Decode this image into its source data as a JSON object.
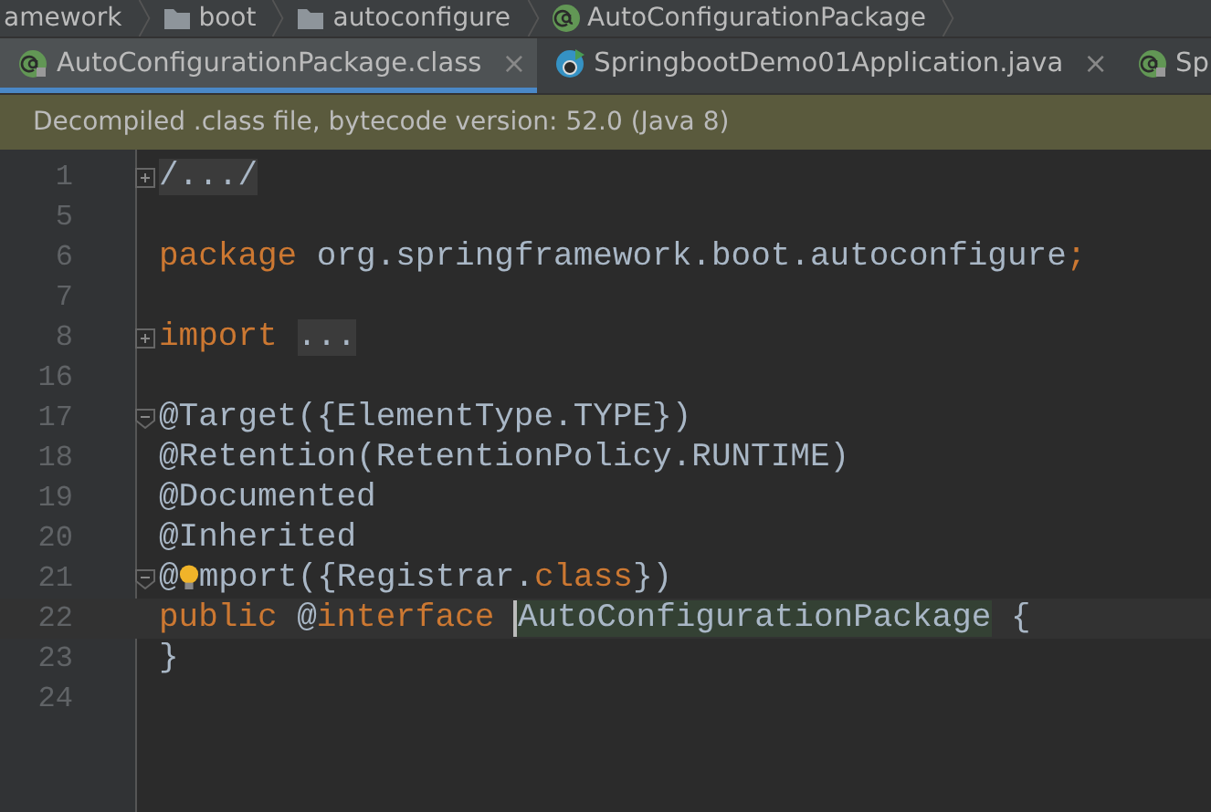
{
  "breadcrumbs": [
    {
      "label": "amework",
      "kind": "plain"
    },
    {
      "label": "boot",
      "kind": "folder"
    },
    {
      "label": "autoconfigure",
      "kind": "folder"
    },
    {
      "label": "AutoConfigurationPackage",
      "kind": "annotation"
    }
  ],
  "tabs": [
    {
      "label": "AutoConfigurationPackage.class",
      "kind": "annotation",
      "selected": true,
      "close": "×"
    },
    {
      "label": "SpringbootDemo01Application.java",
      "kind": "runnable",
      "selected": false,
      "close": "×"
    },
    {
      "label": "Sp",
      "kind": "annotation",
      "selected": false
    }
  ],
  "notification": "Decompiled .class file, bytecode version: 52.0 (Java 8)",
  "lines": [
    {
      "number": "1",
      "expanded": false,
      "tokens": [
        {
          "kind": "folded",
          "text": "/.../"
        }
      ]
    },
    {
      "number": "5"
    },
    {
      "number": "6",
      "tokens": [
        {
          "kind": "keyword",
          "text": "package"
        },
        {
          "kind": "plain",
          "text": " org.springframework.boot.autoconfigure"
        },
        {
          "kind": "keyword",
          "text": ";"
        }
      ]
    },
    {
      "number": "7"
    },
    {
      "number": "8",
      "expanded": false,
      "tokens": [
        {
          "kind": "keyword",
          "text": "import "
        },
        {
          "kind": "folded",
          "text": "..."
        }
      ]
    },
    {
      "number": "16"
    },
    {
      "number": "17",
      "expanded": true,
      "tokens": [
        {
          "kind": "plain",
          "text": "@Target({ElementType.TYPE})"
        }
      ]
    },
    {
      "number": "18",
      "tokens": [
        {
          "kind": "plain",
          "text": "@Retention(RetentionPolicy.RUNTIME)"
        }
      ]
    },
    {
      "number": "19",
      "tokens": [
        {
          "kind": "plain",
          "text": "@Documented"
        }
      ]
    },
    {
      "number": "20",
      "tokens": [
        {
          "kind": "plain",
          "text": "@Inherited"
        }
      ]
    },
    {
      "number": "21",
      "expanded": true,
      "tokens": [
        {
          "kind": "plain",
          "text": "@"
        },
        {
          "kind": "bulb"
        },
        {
          "kind": "plain",
          "text": "mport({Registrar."
        },
        {
          "kind": "keyword",
          "text": "class"
        },
        {
          "kind": "plain",
          "text": "})"
        }
      ]
    },
    {
      "number": "22",
      "current": true,
      "tokens": [
        {
          "kind": "keyword",
          "text": "public"
        },
        {
          "kind": "plain",
          "text": " @"
        },
        {
          "kind": "keyword",
          "text": "interface "
        },
        {
          "kind": "caret"
        },
        {
          "kind": "highlight",
          "text": "AutoConfigurationPackage"
        },
        {
          "kind": "plain",
          "text": " {"
        }
      ]
    },
    {
      "number": "23",
      "tokens": [
        {
          "kind": "plain",
          "text": "}"
        }
      ]
    },
    {
      "number": "24"
    }
  ]
}
